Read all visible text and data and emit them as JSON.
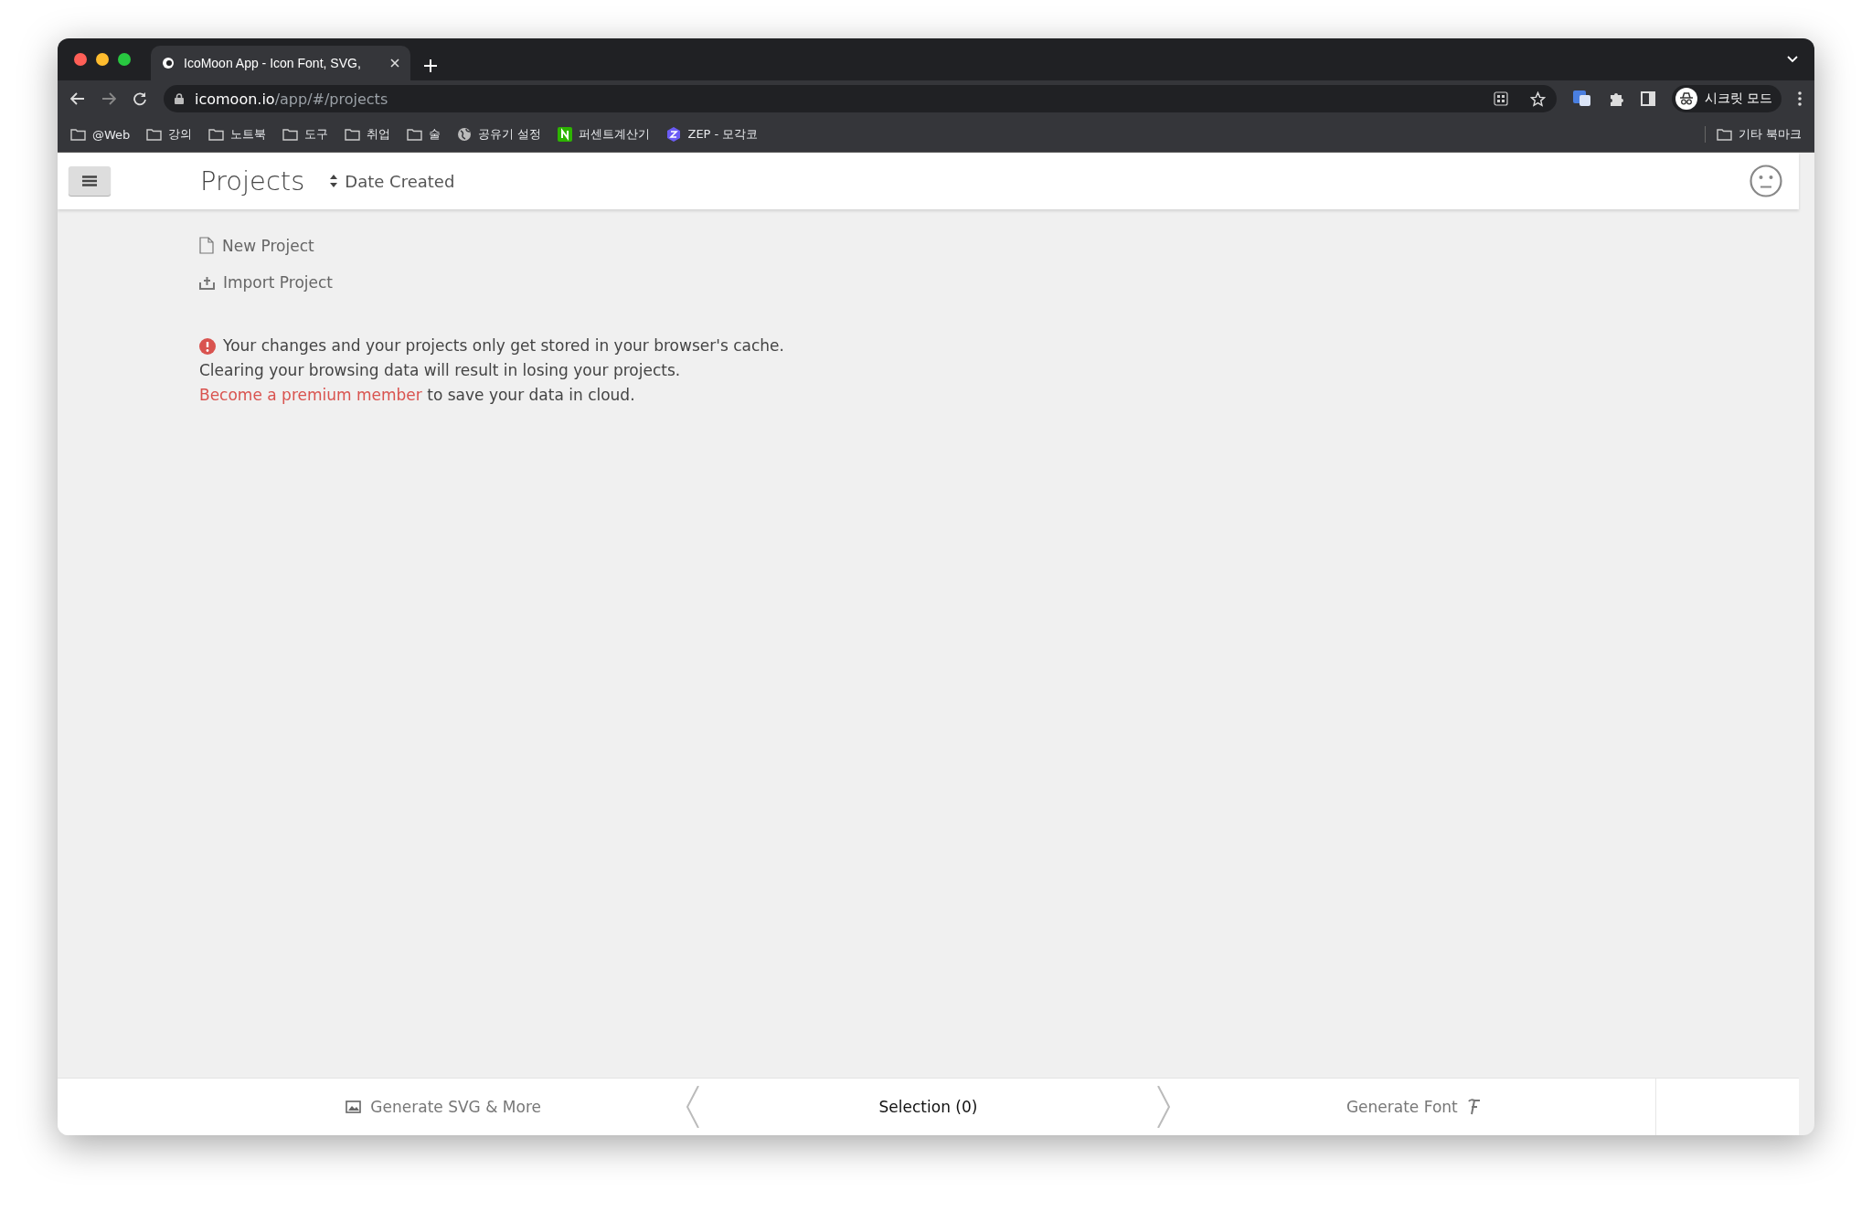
{
  "browser": {
    "tab": {
      "title": "IcoMoon App - Icon Font, SVG,"
    },
    "url": {
      "host": "icomoon.io",
      "path": "/app/#/projects"
    },
    "profile": "시크릿 모드",
    "bookmarks": [
      {
        "label": "@Web",
        "kind": "folder"
      },
      {
        "label": "강의",
        "kind": "folder"
      },
      {
        "label": "노트북",
        "kind": "folder"
      },
      {
        "label": "도구",
        "kind": "folder"
      },
      {
        "label": "취업",
        "kind": "folder"
      },
      {
        "label": "술",
        "kind": "folder"
      },
      {
        "label": "공유기 설정",
        "kind": "globe"
      },
      {
        "label": "퍼센트계산기",
        "kind": "green"
      },
      {
        "label": "ZEP - 모각코",
        "kind": "hexagon"
      }
    ],
    "other_bookmarks": "기타 북마크"
  },
  "app": {
    "title": "Projects",
    "sort": "Date Created",
    "actions": [
      {
        "label": "New Project",
        "kind": "new"
      },
      {
        "label": "Import Project",
        "kind": "import"
      }
    ],
    "notice": {
      "line_1": "Your changes and your projects only get stored in your browser's cache.",
      "line_2": "Clearing your browsing data will result in losing your projects.",
      "link": "Become a premium member",
      "link_rest": "to save your data in cloud."
    }
  },
  "footer": {
    "left": "Generate SVG & More",
    "center": "Selection (0)",
    "right": "Generate Font"
  }
}
